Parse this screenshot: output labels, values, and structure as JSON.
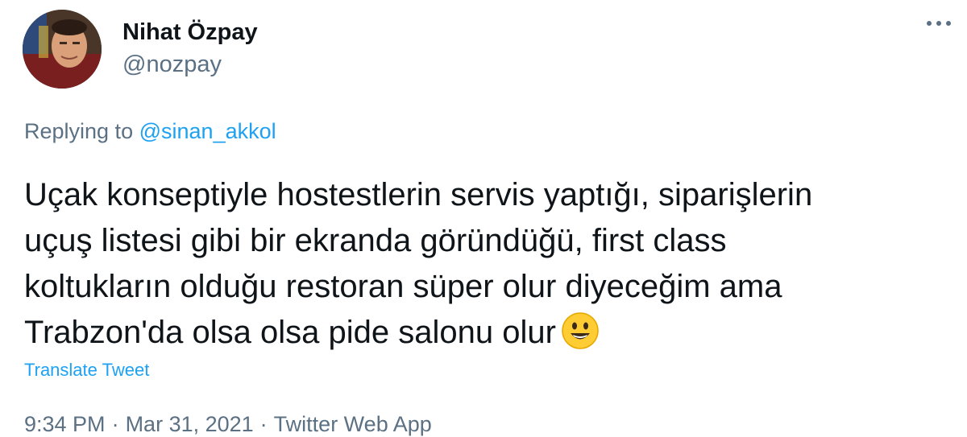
{
  "author": {
    "display_name": "Nihat Özpay",
    "handle": "@nozpay",
    "avatar_icon": "user-avatar"
  },
  "reply": {
    "prefix": "Replying to",
    "mention": "@sinan_akkol"
  },
  "tweet": {
    "lines": [
      "Uçak konseptiyle hostestlerin servis yaptığı, siparişlerin",
      "uçuş listesi gibi bir ekranda göründüğü, first class",
      "koltukların olduğu restoran süper olur diyeceğim ama",
      "Trabzon'da olsa olsa pide salonu olur"
    ],
    "emoji_icon": "smiling-face-icon"
  },
  "translate_label": "Translate Tweet",
  "meta": {
    "time": "9:34 PM",
    "separator": "·",
    "date": "Mar 31, 2021",
    "source": "Twitter Web App"
  },
  "colors": {
    "link": "#1da1f2",
    "secondary_text": "#5b7083",
    "primary_text": "#0f1419"
  }
}
